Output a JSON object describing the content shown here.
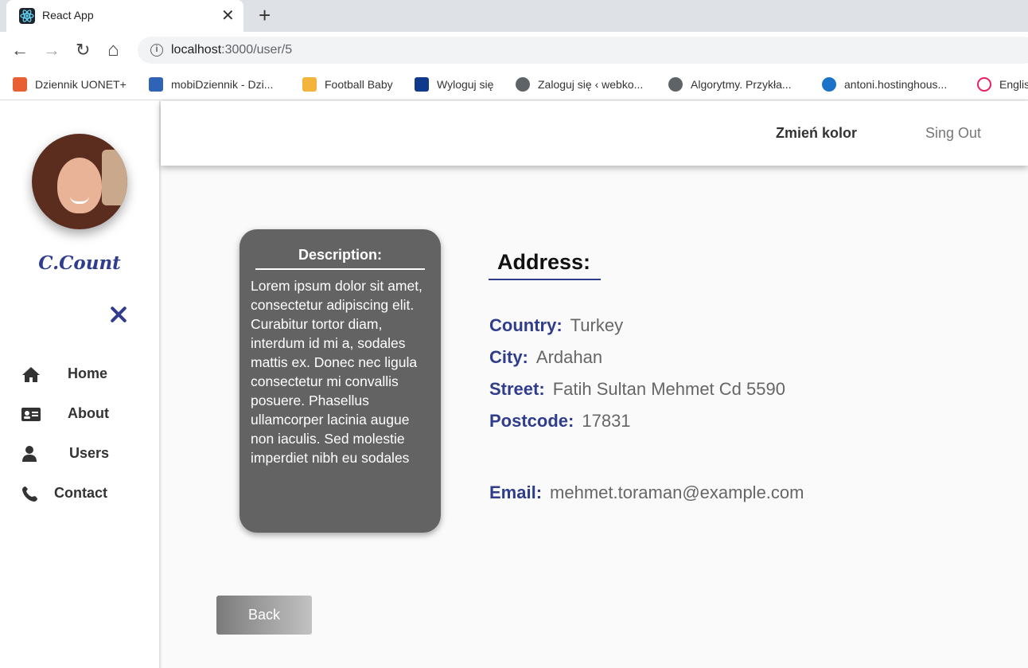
{
  "browser": {
    "tab_title": "React App",
    "new_tab": "+",
    "close": "✕",
    "nav": {
      "back": "←",
      "forward": "→",
      "reload": "↻",
      "home": "⌂"
    },
    "url_host": "localhost",
    "url_path": ":3000/user/5",
    "info_icon": "i",
    "bookmarks": [
      {
        "label": "Dziennik UONET+",
        "color": "#e95f34"
      },
      {
        "label": "mobiDziennik - Dzi...",
        "color": "#2f63b5"
      },
      {
        "label": "Football Baby",
        "color": "#f4b33a"
      },
      {
        "label": "Wyloguj się",
        "color": "#0f3a8c"
      },
      {
        "label": "Zaloguj się ‹ webko...",
        "color": "#5f6368"
      },
      {
        "label": "Algorytmy. Przykła...",
        "color": "#5f6368"
      },
      {
        "label": "antoni.hostinghous...",
        "color": "#1a73c8"
      },
      {
        "label": "Englis",
        "color": "#e91e63"
      }
    ]
  },
  "sidebar": {
    "brand": "C.Count",
    "items": [
      {
        "label": "Home",
        "icon": "home-icon"
      },
      {
        "label": "About",
        "icon": "id-card-icon"
      },
      {
        "label": "Users",
        "icon": "user-icon"
      },
      {
        "label": "Contact",
        "icon": "phone-icon"
      }
    ]
  },
  "header": {
    "change_color": "Zmień kolor",
    "sign_out": "Sing Out"
  },
  "description": {
    "title": "Description:",
    "text": "Lorem ipsum dolor sit amet, consectetur adipiscing elit. Curabitur tortor diam, interdum id mi a, sodales mattis ex. Donec nec ligula consectetur mi convallis posuere. Phasellus ullamcorper lacinia augue non iaculis. Sed molestie imperdiet nibh eu sodales"
  },
  "address": {
    "title": "Address:",
    "country_label": "Country:",
    "country": "Turkey",
    "city_label": "City:",
    "city": "Ardahan",
    "street_label": "Street:",
    "street": "Fatih Sultan Mehmet Cd 5590",
    "postcode_label": "Postcode:",
    "postcode": "17831",
    "email_label": "Email:",
    "email": "mehmet.toraman@example.com"
  },
  "back_label": "Back",
  "colors": {
    "accent": "#2f3d8c",
    "card": "#636363"
  }
}
